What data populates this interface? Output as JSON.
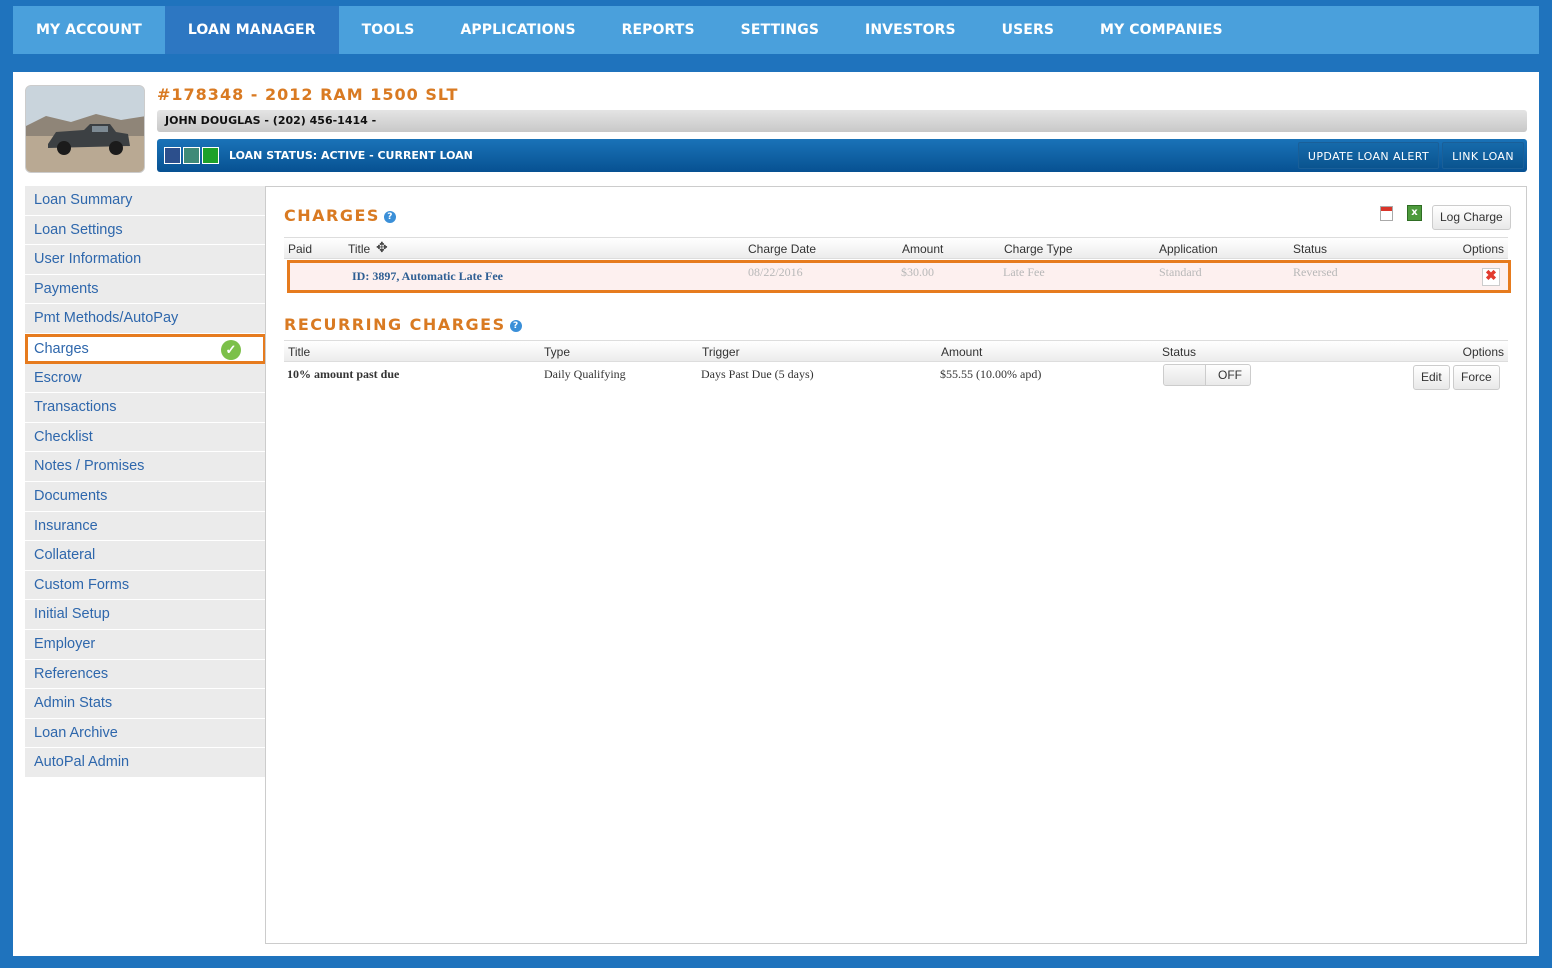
{
  "nav": {
    "items": [
      {
        "label": "MY ACCOUNT"
      },
      {
        "label": "LOAN MANAGER"
      },
      {
        "label": "TOOLS"
      },
      {
        "label": "APPLICATIONS"
      },
      {
        "label": "REPORTS"
      },
      {
        "label": "SETTINGS"
      },
      {
        "label": "INVESTORS"
      },
      {
        "label": "USERS"
      },
      {
        "label": "MY COMPANIES"
      }
    ],
    "active_index": 1
  },
  "loan": {
    "title": "#178348 - 2012 RAM 1500 SLT",
    "contact": "JOHN DOUGLAS - (202) 456-1414 -",
    "status_text": "LOAN STATUS: ACTIVE - CURRENT LOAN",
    "status_colors": [
      "#2c4f8c",
      "#3f8a78",
      "#1da12a"
    ],
    "update_alert_label": "UPDATE LOAN ALERT",
    "link_loan_label": "LINK LOAN"
  },
  "sidebar": {
    "items": [
      {
        "label": "Loan Summary"
      },
      {
        "label": "Loan Settings"
      },
      {
        "label": "User Information"
      },
      {
        "label": "Payments"
      },
      {
        "label": "Pmt Methods/AutoPay"
      },
      {
        "label": "Charges"
      },
      {
        "label": "Escrow"
      },
      {
        "label": "Transactions"
      },
      {
        "label": "Checklist"
      },
      {
        "label": "Notes / Promises"
      },
      {
        "label": "Documents"
      },
      {
        "label": "Insurance"
      },
      {
        "label": "Collateral"
      },
      {
        "label": "Custom Forms"
      },
      {
        "label": "Initial Setup"
      },
      {
        "label": "Employer"
      },
      {
        "label": "References"
      },
      {
        "label": "Admin Stats"
      },
      {
        "label": "Loan Archive"
      },
      {
        "label": "AutoPal Admin"
      }
    ],
    "active_index": 5
  },
  "charges": {
    "title": "CHARGES",
    "log_charge_label": "Log Charge",
    "columns": {
      "paid": "Paid",
      "title": "Title",
      "date": "Charge Date",
      "amount": "Amount",
      "type": "Charge Type",
      "application": "Application",
      "status": "Status",
      "options": "Options"
    },
    "rows": [
      {
        "title": "ID: 3897, Automatic Late Fee",
        "date": "08/22/2016",
        "amount": "$30.00",
        "type": "Late Fee",
        "application": "Standard",
        "status": "Reversed"
      }
    ]
  },
  "recurring": {
    "title": "RECURRING CHARGES",
    "columns": {
      "title": "Title",
      "type": "Type",
      "trigger": "Trigger",
      "amount": "Amount",
      "status": "Status",
      "options": "Options"
    },
    "rows": [
      {
        "title": "10% amount past due",
        "type": "Daily Qualifying",
        "trigger": "Days Past Due (5 days)",
        "amount": "$55.55 (10.00% apd)",
        "toggle": "OFF",
        "edit_label": "Edit",
        "force_label": "Force"
      }
    ]
  }
}
